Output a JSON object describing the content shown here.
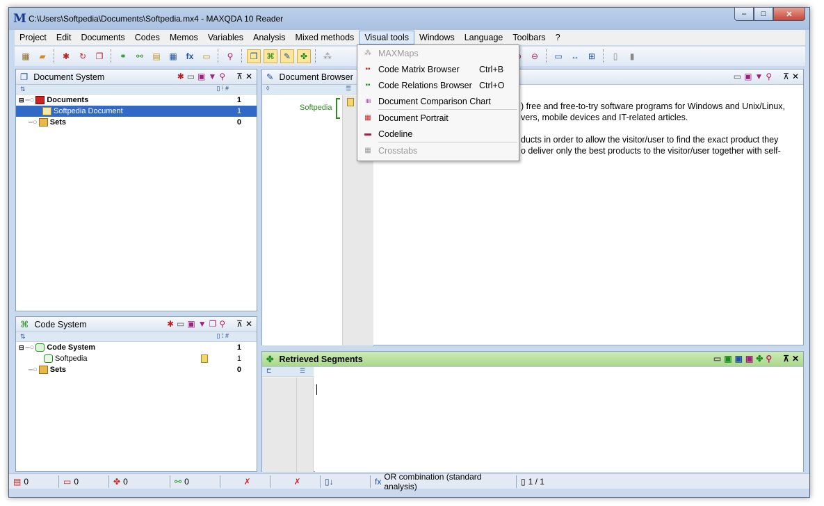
{
  "window": {
    "title": "C:\\Users\\Softpedia\\Documents\\Softpedia.mx4 - MAXQDA 10 Reader",
    "app_icon": "M"
  },
  "window_buttons": {
    "min": "–",
    "max": "□",
    "close": "✕"
  },
  "menu": [
    "Project",
    "Edit",
    "Documents",
    "Codes",
    "Memos",
    "Variables",
    "Analysis",
    "Mixed methods",
    "Visual tools",
    "Windows",
    "Language",
    "Toolbars",
    "?"
  ],
  "document_system": {
    "title": "Document System",
    "rows": [
      {
        "label": "Documents",
        "count": "1",
        "bold": true
      },
      {
        "label": "Softpedia Document",
        "count": "1",
        "selected": true
      },
      {
        "label": "Sets",
        "count": "0",
        "bold": true
      }
    ]
  },
  "code_system": {
    "title": "Code System",
    "rows": [
      {
        "label": "Code System",
        "count": "1",
        "bold": true
      },
      {
        "label": "Softpedia",
        "count": "1"
      },
      {
        "label": "Sets",
        "count": "0",
        "bold": true
      }
    ]
  },
  "document_browser": {
    "title": "Document Browser",
    "code_label": "Softpedia",
    "text_line1": ") free and free-to-try software programs for Windows and Unix/Linux,",
    "text_line2": "vers, mobile devices and IT-related articles.",
    "text_line3": "ducts in order to allow the visitor/user to find the exact product they",
    "text_line4": "o deliver only the best products to the visitor/user together with self-"
  },
  "retrieved_segments": {
    "title": "Retrieved Segments"
  },
  "visual_tools_menu": [
    {
      "label": "MAXMaps",
      "shortcut": "",
      "disabled": true
    },
    {
      "label": "Code Matrix Browser",
      "shortcut": "Ctrl+B"
    },
    {
      "label": "Code Relations Browser",
      "shortcut": "Ctrl+O"
    },
    {
      "label": "Document Comparison Chart",
      "shortcut": ""
    },
    {
      "label": "Document Portrait",
      "shortcut": ""
    },
    {
      "label": "Codeline",
      "shortcut": ""
    },
    {
      "label": "Crosstabs",
      "shortcut": "",
      "disabled": true
    }
  ],
  "status": {
    "docs": "0",
    "memos": "0",
    "codes": "0",
    "seg": "0",
    "mode": "OR combination (standard analysis)",
    "pages": "1 / 1"
  },
  "colors": {
    "accent": "#3169c6",
    "green_header": "#b8df9b",
    "code_green": "#2e8b20"
  }
}
